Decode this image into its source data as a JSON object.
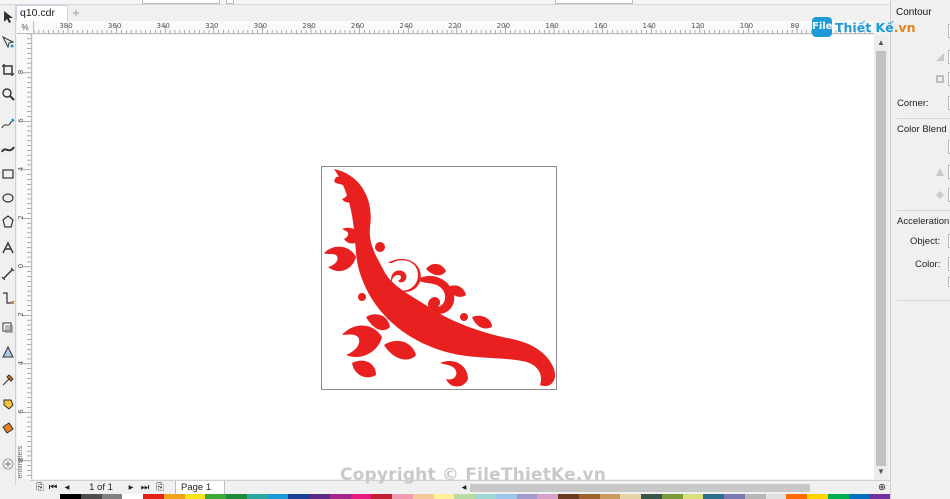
{
  "app": {
    "document_tab": "q10.cdr",
    "new_tab_symbol": "+"
  },
  "ruler": {
    "unit_symbol": "%",
    "top_ticks": [
      "380",
      "360",
      "340",
      "320",
      "300",
      "280",
      "260",
      "240",
      "220",
      "200",
      "180",
      "160",
      "140",
      "120",
      "100",
      "80"
    ],
    "left_ticks": [
      "8",
      "6",
      "4",
      "2",
      "0",
      "2",
      "4",
      "6",
      "8"
    ],
    "left_unit_label": "centimeters"
  },
  "pagebar": {
    "page_counter": "1 of 1",
    "page_tab_label": "Page 1"
  },
  "docker": {
    "title": "Contour",
    "corner_label": "Corner:",
    "color_blend_label": "Color Blend",
    "acceleration_label": "Acceleration",
    "object_label": "Object:",
    "color_label": "Color:"
  },
  "logo": {
    "badge": "File",
    "name_main": "Thiết Kế",
    "name_suffix": ".vn"
  },
  "watermark": "Copyright © FileThietKe.vn",
  "colors": {
    "ornament": "#e8201f",
    "logo_blue": "#1e9ad6",
    "logo_orange": "#e8821e",
    "watermark": "#c9c9c9"
  },
  "palette": [
    "#000000",
    "#4d4d4d",
    "#808080",
    "#ffffff",
    "#e32118",
    "#f2a31b",
    "#f7e51c",
    "#3aa935",
    "#1d8a3c",
    "#2ba6a0",
    "#1a9ad6",
    "#1b3f95",
    "#5b2a86",
    "#a3268a",
    "#e5197e",
    "#c02132",
    "#f29ab0",
    "#f7c89b",
    "#fff09a",
    "#b9dca3",
    "#9fd7d4",
    "#9cc6ea",
    "#a49bcc",
    "#d7a3cc",
    "#6b3a1f",
    "#a0622d",
    "#c99b5f",
    "#e6d3a8",
    "#36564a",
    "#7a9a3a",
    "#d7e07a",
    "#2d6e8e",
    "#7a7ab3",
    "#b7b7b7",
    "#e0e0e0",
    "#ff6a00",
    "#ffd500",
    "#00b050",
    "#0070c0",
    "#7030a0"
  ],
  "tools": [
    "pick-tool-icon",
    "shape-tool-icon",
    "crop-tool-icon",
    "zoom-tool-icon",
    "freehand-tool-icon",
    "artistic-media-icon",
    "rectangle-tool-icon",
    "ellipse-tool-icon",
    "polygon-tool-icon",
    "text-tool-icon",
    "parallel-dimension-icon",
    "connector-tool-icon",
    "drop-shadow-icon",
    "transparency-icon",
    "eyedropper-icon",
    "interactive-fill-icon",
    "smart-fill-icon",
    "add-tool-icon"
  ]
}
